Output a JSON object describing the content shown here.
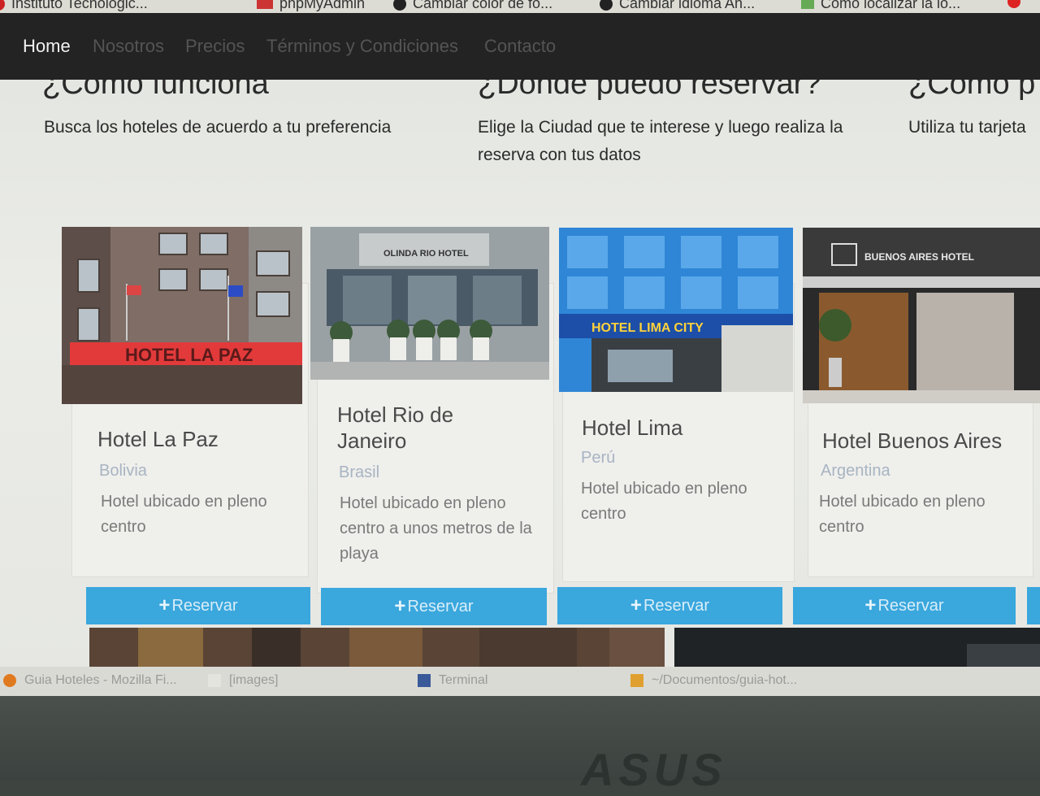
{
  "bookmarks": [
    "Instituto Tecnologic...",
    "phpMyAdmin",
    "Cambiar color de fo...",
    "Cambiar idioma An...",
    "Como localizar la lo..."
  ],
  "nav": {
    "items": [
      "Home",
      "Nosotros",
      "Precios",
      "Términos y Condiciones",
      "Contacto"
    ]
  },
  "info": [
    {
      "heading": "¿Como funciona",
      "text": "Busca los hoteles de acuerdo a tu preferencia"
    },
    {
      "heading": "¿Donde puedo reservar?",
      "text": "Elige la Ciudad que te interese y luego realiza la reserva con tus datos"
    },
    {
      "heading": "¿Como p",
      "text": "Utiliza tu tarjeta"
    }
  ],
  "hotels": [
    {
      "name": "Hotel La Paz",
      "country": "Bolivia",
      "description": "Hotel ubicado en pleno centro",
      "sign": "HOTEL LA PAZ",
      "button": "Reservar"
    },
    {
      "name": "Hotel Rio de Janeiro",
      "country": "Brasil",
      "description": "Hotel ubicado en pleno centro a unos metros de la playa",
      "sign": "OLINDA RIO HOTEL",
      "button": "Reservar"
    },
    {
      "name": "Hotel Lima",
      "country": "Perú",
      "description": "Hotel ubicado en pleno centro",
      "sign": "HOTEL LIMA CITY",
      "button": "Reservar"
    },
    {
      "name": "Hotel Buenos Aires",
      "country": "Argentina",
      "description": "Hotel ubicado en pleno centro",
      "sign": "BUENOS AIRES HOTEL",
      "button": "Reservar"
    }
  ],
  "taskbar": [
    "Guia Hoteles - Mozilla Fi...",
    "[images]",
    "Terminal",
    "~/Documentos/guia-hot..."
  ],
  "device_brand": "ASUS",
  "colors": {
    "navbar": "#232323",
    "button": "#3aa7dd",
    "country": "#a8b4c2"
  }
}
